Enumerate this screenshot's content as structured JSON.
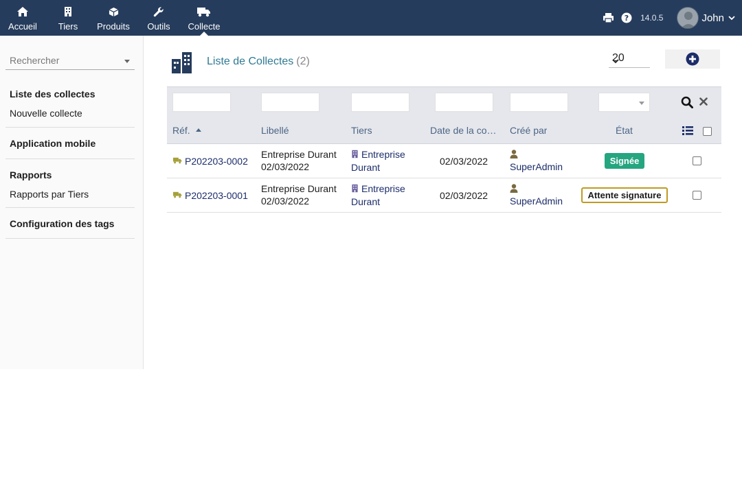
{
  "nav": {
    "items": [
      {
        "label": "Accueil",
        "icon": "home-icon"
      },
      {
        "label": "Tiers",
        "icon": "building-icon"
      },
      {
        "label": "Produits",
        "icon": "cube-icon"
      },
      {
        "label": "Outils",
        "icon": "wrench-icon"
      },
      {
        "label": "Collecte",
        "icon": "truck-icon"
      }
    ],
    "active": "Collecte",
    "version": "14.0.5",
    "user": "John"
  },
  "sidebar": {
    "search_placeholder": "Rechercher",
    "blocks": [
      {
        "title": "Liste des collectes",
        "links": [
          "Nouvelle collecte"
        ]
      },
      {
        "title": "Application mobile",
        "links": []
      },
      {
        "title": "Rapports",
        "links": [
          "Rapports par Tiers"
        ]
      },
      {
        "title": "Configuration des tags",
        "links": []
      }
    ]
  },
  "page": {
    "title": "Liste de Collectes",
    "count": "(2)",
    "limit": "20"
  },
  "table": {
    "columns": [
      "Réf.",
      "Libellé",
      "Tiers",
      "Date de la co…",
      "Créé par",
      "État"
    ],
    "rows": [
      {
        "ref": "P202203-0002",
        "label_line1": "Entreprise Durant",
        "label_line2": "02/03/2022",
        "tiers_line1": "Entreprise",
        "tiers_line2": "Durant",
        "date": "02/03/2022",
        "creator": "SuperAdmin",
        "status": "Signée",
        "status_style": "green"
      },
      {
        "ref": "P202203-0001",
        "label_line1": "Entreprise Durant",
        "label_line2": "02/03/2022",
        "tiers_line1": "Entreprise",
        "tiers_line2": "Durant",
        "date": "02/03/2022",
        "creator": "SuperAdmin",
        "status": "Attente signature",
        "status_style": "outline"
      }
    ]
  },
  "colors": {
    "topbar": "#263c5c",
    "accent_title": "#2f7a94",
    "status_signed": "#25a580",
    "status_pending_border": "#bf9a23"
  }
}
